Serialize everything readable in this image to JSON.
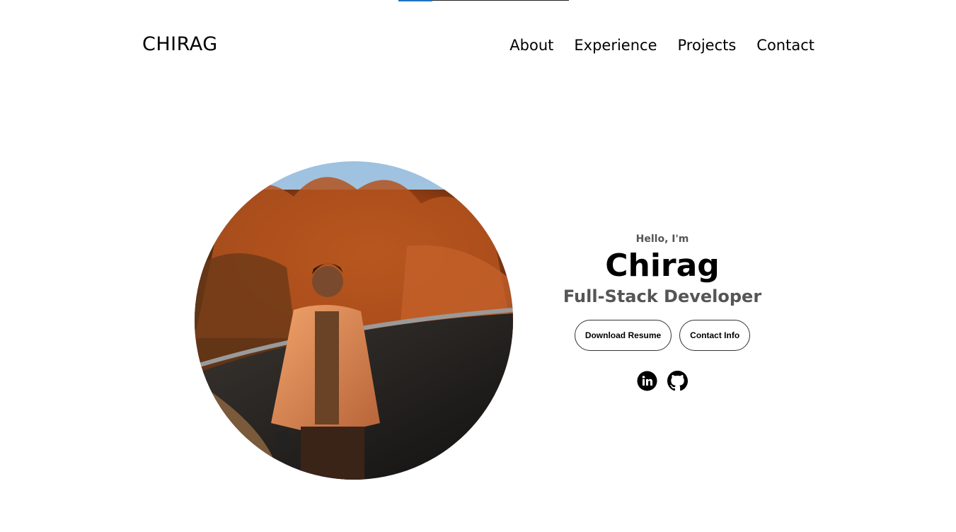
{
  "nav": {
    "logo": "CHIRAG",
    "links": [
      "About",
      "Experience",
      "Projects",
      "Contact"
    ]
  },
  "scroll_progress": 0.2,
  "hero": {
    "greeting": "Hello, I'm",
    "name": "Chirag",
    "role": "Full-Stack Developer",
    "buttons": {
      "resume": "Download Resume",
      "contact": "Contact Info"
    },
    "socials": [
      "linkedin-icon",
      "github-icon"
    ]
  },
  "colors": {
    "accent": "#1e73be",
    "text": "#000000",
    "muted": "#555555"
  }
}
